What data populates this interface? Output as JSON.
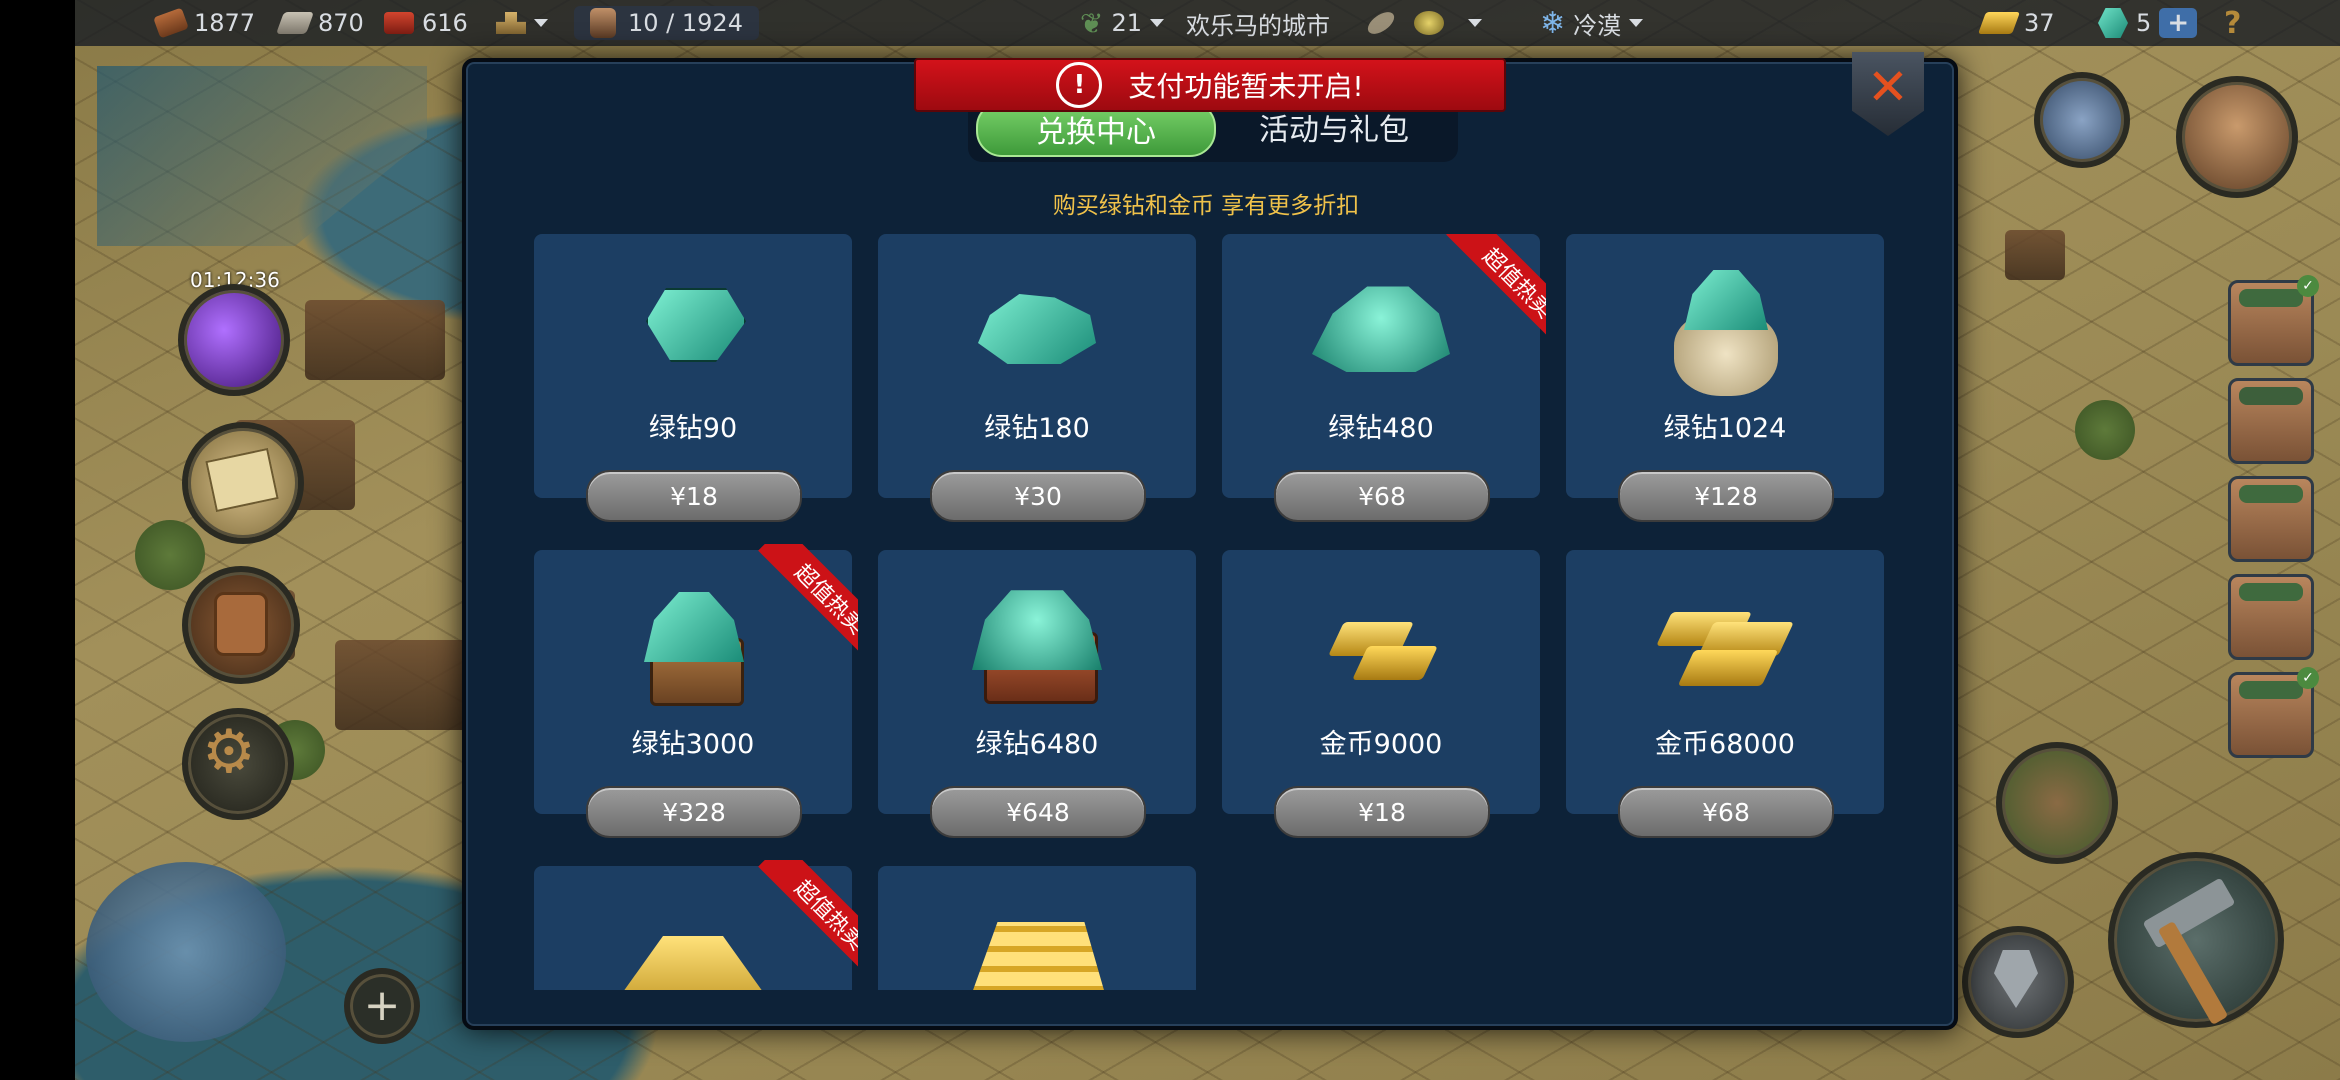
{
  "topbar": {
    "wood": "1877",
    "stone": "870",
    "brick": "616",
    "population": "10 / 1924",
    "level": "21",
    "city_name": "欢乐马的城市",
    "season": "冷漠",
    "gold": "37",
    "green_diamond": "5",
    "add_label": "+",
    "help_label": "?"
  },
  "left_panel": {
    "timer": "01:12:36",
    "add_label": "+"
  },
  "modal": {
    "alert_text": "支付功能暂未开启!",
    "alert_icon_label": "!",
    "close_label": "✕",
    "tabs": [
      {
        "label": "兑换中心"
      },
      {
        "label": "活动与礼包"
      }
    ],
    "subtitle": "购买绿钻和金币 享有更多折扣",
    "ribbon_text": "超值热卖",
    "items": [
      {
        "name": "绿钻90",
        "price": "¥18"
      },
      {
        "name": "绿钻180",
        "price": "¥30"
      },
      {
        "name": "绿钻480",
        "price": "¥68"
      },
      {
        "name": "绿钻1024",
        "price": "¥128"
      },
      {
        "name": "绿钻3000",
        "price": "¥328"
      },
      {
        "name": "绿钻6480",
        "price": "¥648"
      },
      {
        "name": "金币9000",
        "price": "¥18"
      },
      {
        "name": "金币68000",
        "price": "¥68"
      }
    ]
  },
  "colors": {
    "modal_bg": "#0d2238",
    "card_bg": "#1c3e63",
    "alert_red": "#c40f16",
    "tab_active": "#4fae45",
    "subtitle_gold": "#f0c24a"
  }
}
